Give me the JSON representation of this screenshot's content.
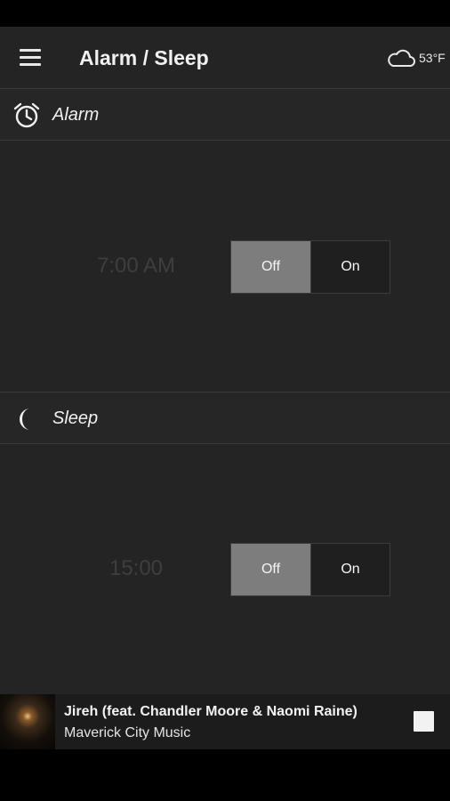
{
  "app_bar": {
    "title": "Alarm / Sleep",
    "weather": {
      "icon": "cloud-icon",
      "temperature": "53°F"
    }
  },
  "alarm": {
    "header": "Alarm",
    "icon": "alarm-clock-icon",
    "time": "7:00 AM",
    "toggle": {
      "off_label": "Off",
      "on_label": "On",
      "selected": "Off"
    }
  },
  "sleep": {
    "header": "Sleep",
    "icon": "moon-icon",
    "time": "15:00",
    "toggle": {
      "off_label": "Off",
      "on_label": "On",
      "selected": "Off"
    }
  },
  "now_playing": {
    "title": "Jireh (feat. Chandler Moore & Naomi Raine)",
    "artist": "Maverick City Music",
    "control_icon": "stop-icon"
  },
  "colors": {
    "background": "#242424",
    "selected_toggle": "#7d7d7d",
    "dim_text": "#3e3e3e"
  }
}
